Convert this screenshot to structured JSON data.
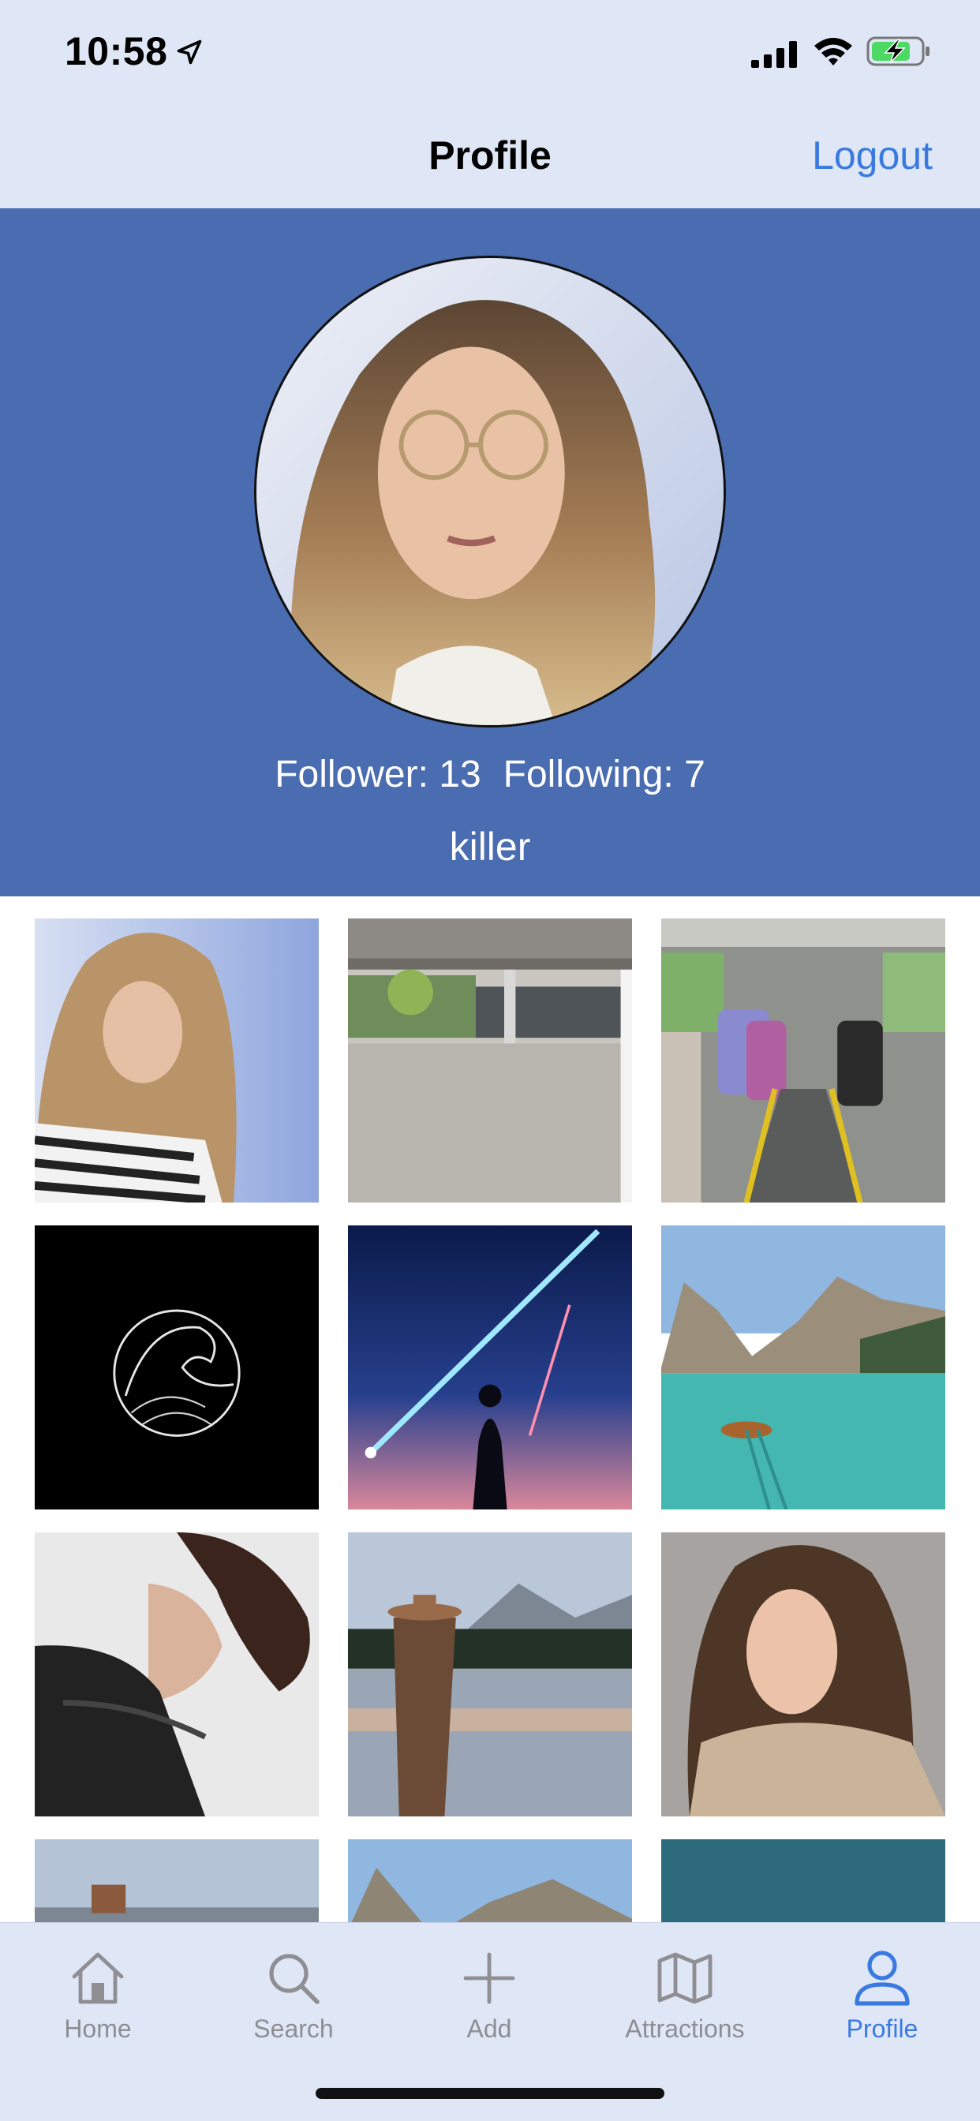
{
  "status_bar": {
    "time": "10:58",
    "icons": [
      "location-arrow-icon",
      "cellular-signal-icon",
      "wifi-icon",
      "battery-charging-icon"
    ]
  },
  "nav": {
    "title": "Profile",
    "logout_label": "Logout"
  },
  "profile": {
    "follower_text": "Follower: 13",
    "following_text": "Following: 7",
    "username": "killer",
    "avatar_icon": "profile-photo"
  },
  "photos": [
    {
      "name": "photo-woman-glasses"
    },
    {
      "name": "photo-covered-walkway"
    },
    {
      "name": "photo-bus-interior"
    },
    {
      "name": "photo-wave-drawing"
    },
    {
      "name": "photo-comet-sky"
    },
    {
      "name": "photo-mountain-lake-boat"
    },
    {
      "name": "photo-woman-black-dress"
    },
    {
      "name": "photo-woman-hat-lake"
    },
    {
      "name": "photo-woman-sweater"
    },
    {
      "name": "photo-landscape-partial"
    },
    {
      "name": "photo-mountains-partial"
    },
    {
      "name": "photo-teal-partial"
    }
  ],
  "tabs": [
    {
      "label": "Home",
      "icon": "home-icon"
    },
    {
      "label": "Search",
      "icon": "search-icon"
    },
    {
      "label": "Add",
      "icon": "plus-icon"
    },
    {
      "label": "Attractions",
      "icon": "map-icon"
    },
    {
      "label": "Profile",
      "icon": "person-icon"
    }
  ],
  "colors": {
    "header_band": "#4a6cb0",
    "bar_background": "#dfe6f6",
    "accent": "#3a7ae0",
    "inactive": "#8e8e93"
  }
}
